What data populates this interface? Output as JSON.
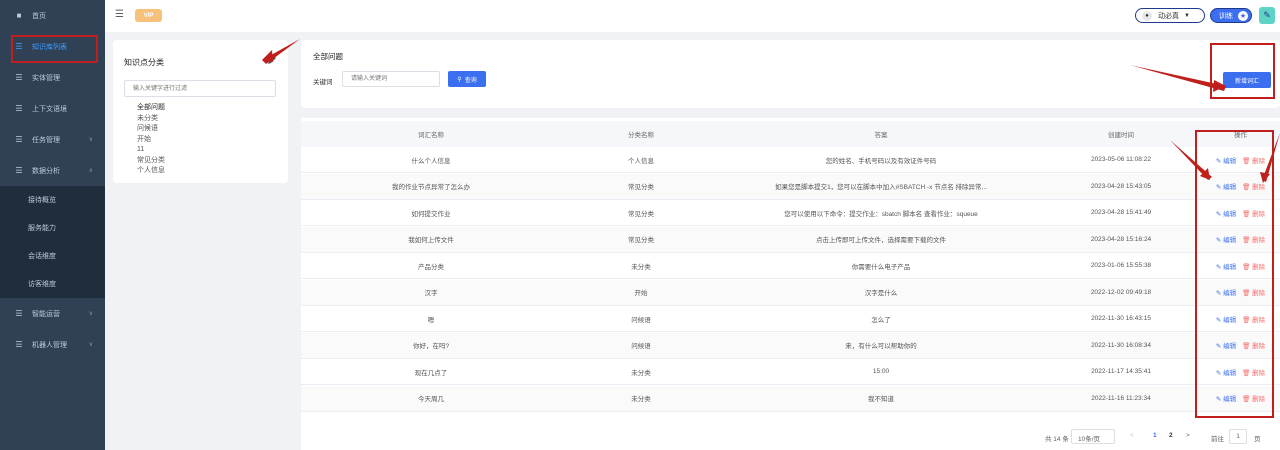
{
  "sidebar": {
    "items": [
      {
        "label": "首页",
        "icon": "home-icon"
      },
      {
        "label": "知识库列表",
        "icon": "list-icon"
      },
      {
        "label": "实体管理",
        "icon": "list-icon"
      },
      {
        "label": "上下文语境",
        "icon": "list-icon"
      },
      {
        "label": "任务管理",
        "icon": "list-icon"
      },
      {
        "label": "数据分析",
        "icon": "list-icon"
      }
    ],
    "sub_items": [
      "接待概览",
      "服务能力",
      "会话维度",
      "访客维度"
    ],
    "bottom_items": [
      {
        "label": "智能运营",
        "icon": "list-icon"
      },
      {
        "label": "机器人管理",
        "icon": "list-icon"
      }
    ],
    "active_color": "#409eff"
  },
  "topbar": {
    "badge": "VIP",
    "user_name": "动必真",
    "train_label": "训练"
  },
  "category": {
    "title": "知识点分类",
    "filter_placeholder": "输入关键字进行过滤",
    "tree": [
      "全部问题",
      "未分类",
      "问候语",
      "开始",
      "11",
      "常见分类",
      "个人信息"
    ]
  },
  "search": {
    "title": "全部问题",
    "keyword_label": "关键词",
    "keyword_placeholder": "请输入关键词",
    "search_button": "查询",
    "add_button": "新增词汇"
  },
  "table": {
    "headers": [
      "词汇名称",
      "分类名称",
      "答案",
      "创建时间",
      "操作"
    ],
    "edit_label": "编辑",
    "delete_label": "删除",
    "rows": [
      {
        "name": "什么个人信息",
        "category": "个人信息",
        "answer": "您的姓名、手机号码以及有效证件号码",
        "time": "2023-05-06 11:08:22"
      },
      {
        "name": "我的作业节点异常了怎么办",
        "category": "常见分类",
        "answer": "如果您是脚本提交1，您可以在脚本中加入#SBATCH -x 节点名 排除异常...",
        "time": "2023-04-28 15:43:05"
      },
      {
        "name": "如何提交作业",
        "category": "常见分类",
        "answer": "您可以使用以下命令：提交作业：sbatch 脚本名 查看作业：squeue",
        "time": "2023-04-28 15:41:49"
      },
      {
        "name": "我如何上传文件",
        "category": "常见分类",
        "answer": "点击上传即可上传文件，选择需要下载的文件",
        "time": "2023-04-28 15:16:24"
      },
      {
        "name": "产品分类",
        "category": "未分类",
        "answer": "你需要什么电子产品",
        "time": "2023-01-06 15:55:38"
      },
      {
        "name": "汉字",
        "category": "开始",
        "answer": "汉字是什么",
        "time": "2022-12-02 09:49:18"
      },
      {
        "name": "嗯",
        "category": "问候语",
        "answer": "怎么了",
        "time": "2022-11-30 16:43:15"
      },
      {
        "name": "你好，在吗?",
        "category": "问候语",
        "answer": "来，有什么可以帮助你的",
        "time": "2022-11-30 16:08:34"
      },
      {
        "name": "现在几点了",
        "category": "未分类",
        "answer": "15:00",
        "time": "2022-11-17 14:35:41"
      },
      {
        "name": "今天周几",
        "category": "未分类",
        "answer": "我不知道",
        "time": "2022-11-16 11:23:34"
      }
    ]
  },
  "pagination": {
    "total": "共 14 条",
    "page_size": "10条/页",
    "pages": [
      "1",
      "2"
    ],
    "current_page": "1",
    "goto_label": "前往",
    "goto_value": "1",
    "unit": "页"
  },
  "colors": {
    "primary": "#3b6ff0",
    "danger": "#f56c6c",
    "annotation": "#e02020"
  }
}
